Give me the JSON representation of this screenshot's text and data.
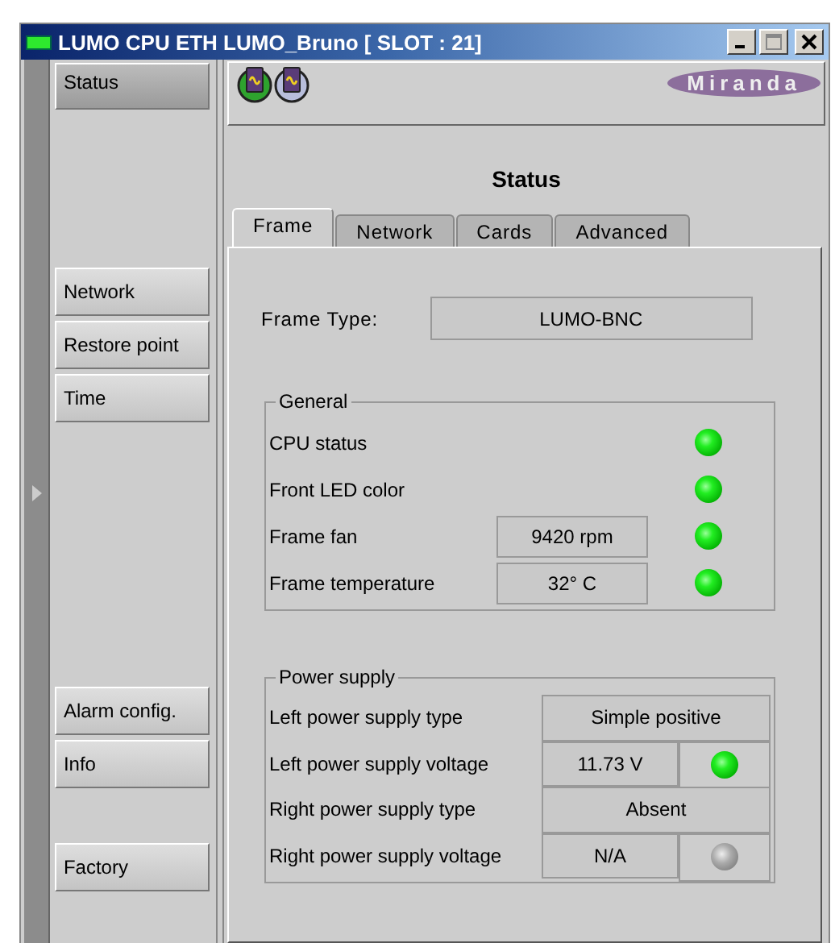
{
  "window": {
    "title": "LUMO CPU ETH LUMO_Bruno [ SLOT : 21]"
  },
  "sidebar": {
    "groups": [
      [
        {
          "label": "Status",
          "selected": true
        }
      ],
      [
        {
          "label": "Network",
          "selected": false
        },
        {
          "label": "Restore point",
          "selected": false
        },
        {
          "label": "Time",
          "selected": false
        }
      ],
      [
        {
          "label": "Alarm config.",
          "selected": false
        },
        {
          "label": "Info",
          "selected": false
        }
      ],
      [
        {
          "label": "Factory",
          "selected": false
        }
      ]
    ]
  },
  "header": {
    "logo": "Miranda"
  },
  "heading": "Status",
  "tabs": [
    {
      "label": "Frame",
      "selected": true
    },
    {
      "label": "Network",
      "selected": false
    },
    {
      "label": "Cards",
      "selected": false
    },
    {
      "label": "Advanced",
      "selected": false
    }
  ],
  "frame_type": {
    "label": "Frame Type:",
    "value": "LUMO-BNC"
  },
  "groups": [
    {
      "title": "General",
      "rows": [
        {
          "kind": "led",
          "label": "CPU status",
          "lit": true
        },
        {
          "kind": "led",
          "label": "Front LED color",
          "lit": true
        },
        {
          "kind": "value_led",
          "label": "Frame fan",
          "value": "9420 rpm",
          "lit": true
        },
        {
          "kind": "value_led",
          "label": "Frame temperature",
          "value": "32° C",
          "lit": true
        }
      ]
    },
    {
      "title": "Power supply",
      "rows": [
        {
          "kind": "wide_value",
          "label": "Left power supply type",
          "value": "Simple positive"
        },
        {
          "kind": "value_led",
          "label": "Left power supply voltage",
          "value": "11.73 V",
          "lit": true
        },
        {
          "kind": "wide_value",
          "label": "Right power supply type",
          "value": "Absent"
        },
        {
          "kind": "value_led",
          "label": "Right power supply voltage",
          "value": "N/A",
          "lit": false
        }
      ]
    }
  ]
}
